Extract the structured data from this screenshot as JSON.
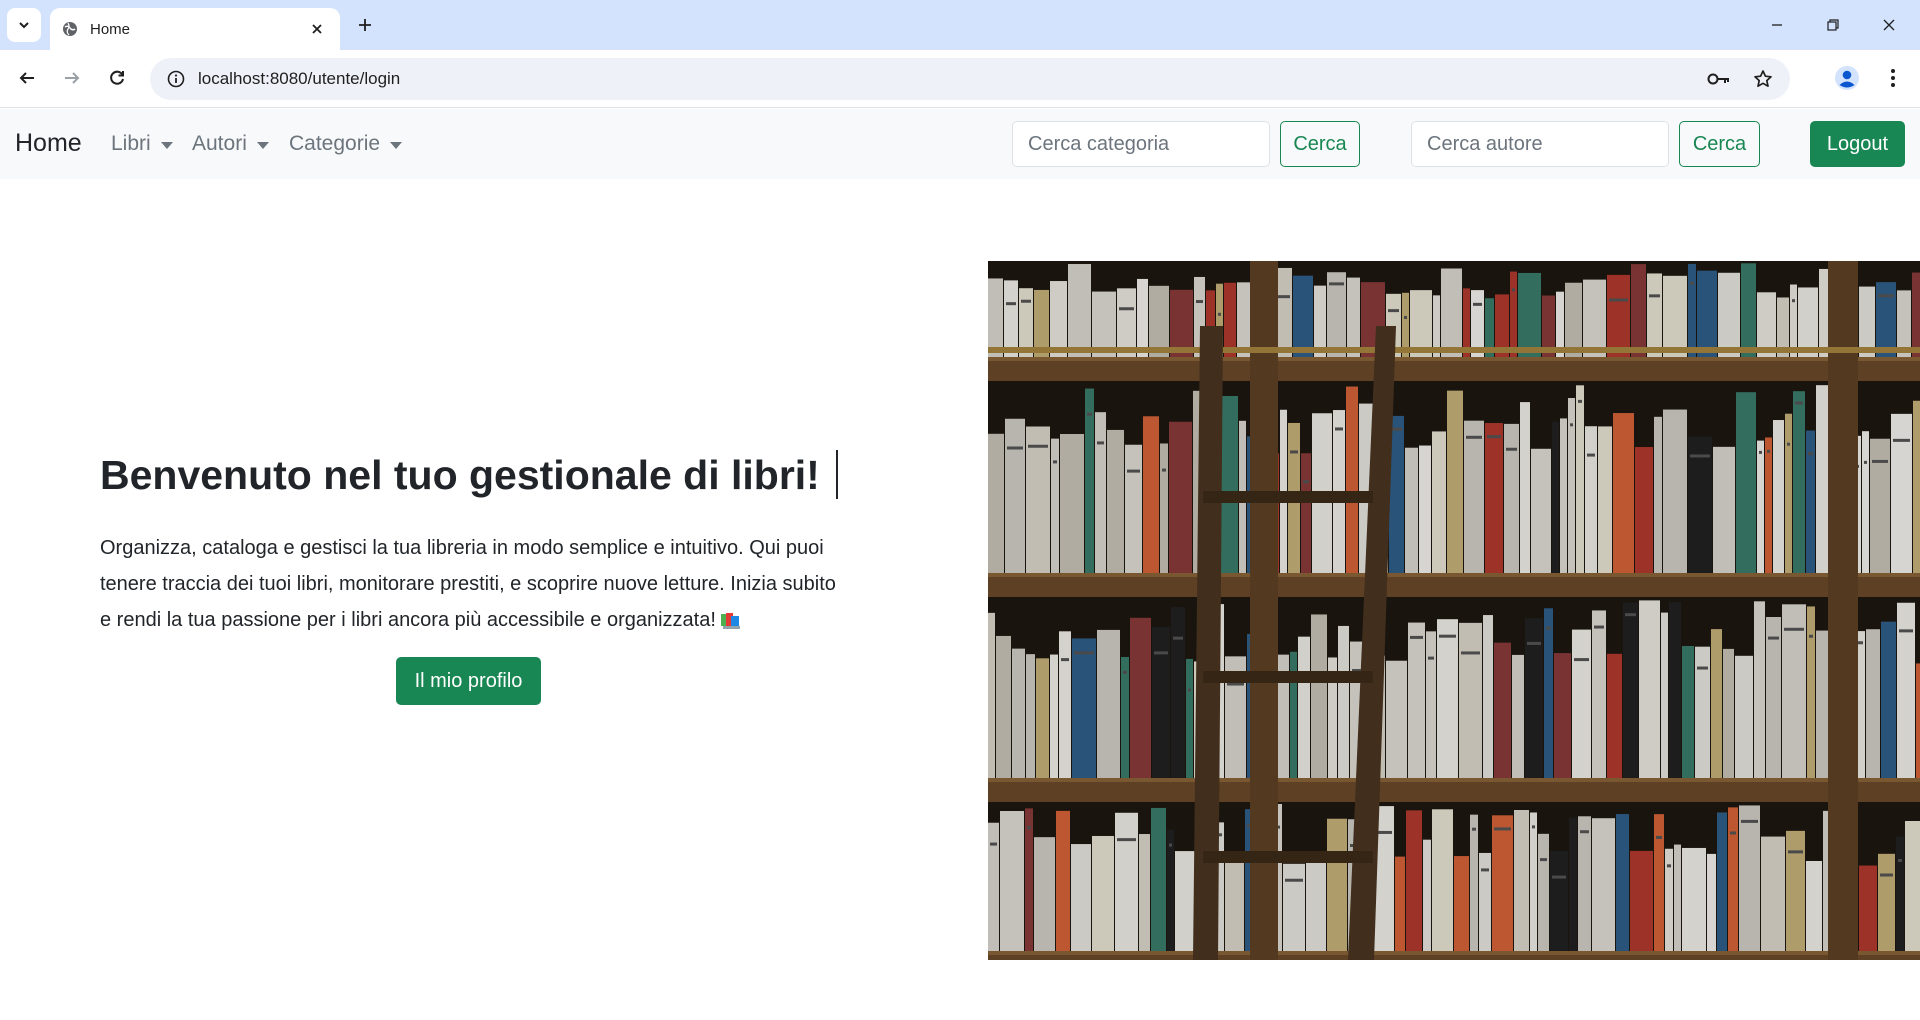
{
  "browser": {
    "tab_title": "Home",
    "url": "localhost:8080/utente/login"
  },
  "navbar": {
    "brand": "Home",
    "menus": [
      {
        "label": "Libri"
      },
      {
        "label": "Autori"
      },
      {
        "label": "Categorie"
      }
    ],
    "category_search": {
      "placeholder": "Cerca categoria",
      "button": "Cerca"
    },
    "author_search": {
      "placeholder": "Cerca autore",
      "button": "Cerca"
    },
    "logout": "Logout"
  },
  "hero": {
    "title": "Benvenuto nel tuo gestionale di libri!",
    "text": "Organizza, cataloga e gestisci la tua libreria in modo semplice e intuitivo. Qui puoi tenere traccia dei tuoi libri, monitorare prestiti, e scoprire nuove letture. Inizia subito e rendi la tua passione per i libri ancora più accessibile e organizzata!",
    "cta": "Il mio profilo"
  },
  "colors": {
    "accent": "#198754",
    "tabstrip": "#d3e3fd",
    "navbar_bg": "#f8f9fa"
  },
  "icons": [
    "tab-search-icon",
    "globe-icon",
    "close-icon",
    "plus-icon",
    "minimize-icon",
    "restore-icon",
    "back-icon",
    "forward-icon",
    "reload-icon",
    "info-icon",
    "key-icon",
    "star-icon",
    "profile-icon",
    "more-icon",
    "books-icon"
  ]
}
